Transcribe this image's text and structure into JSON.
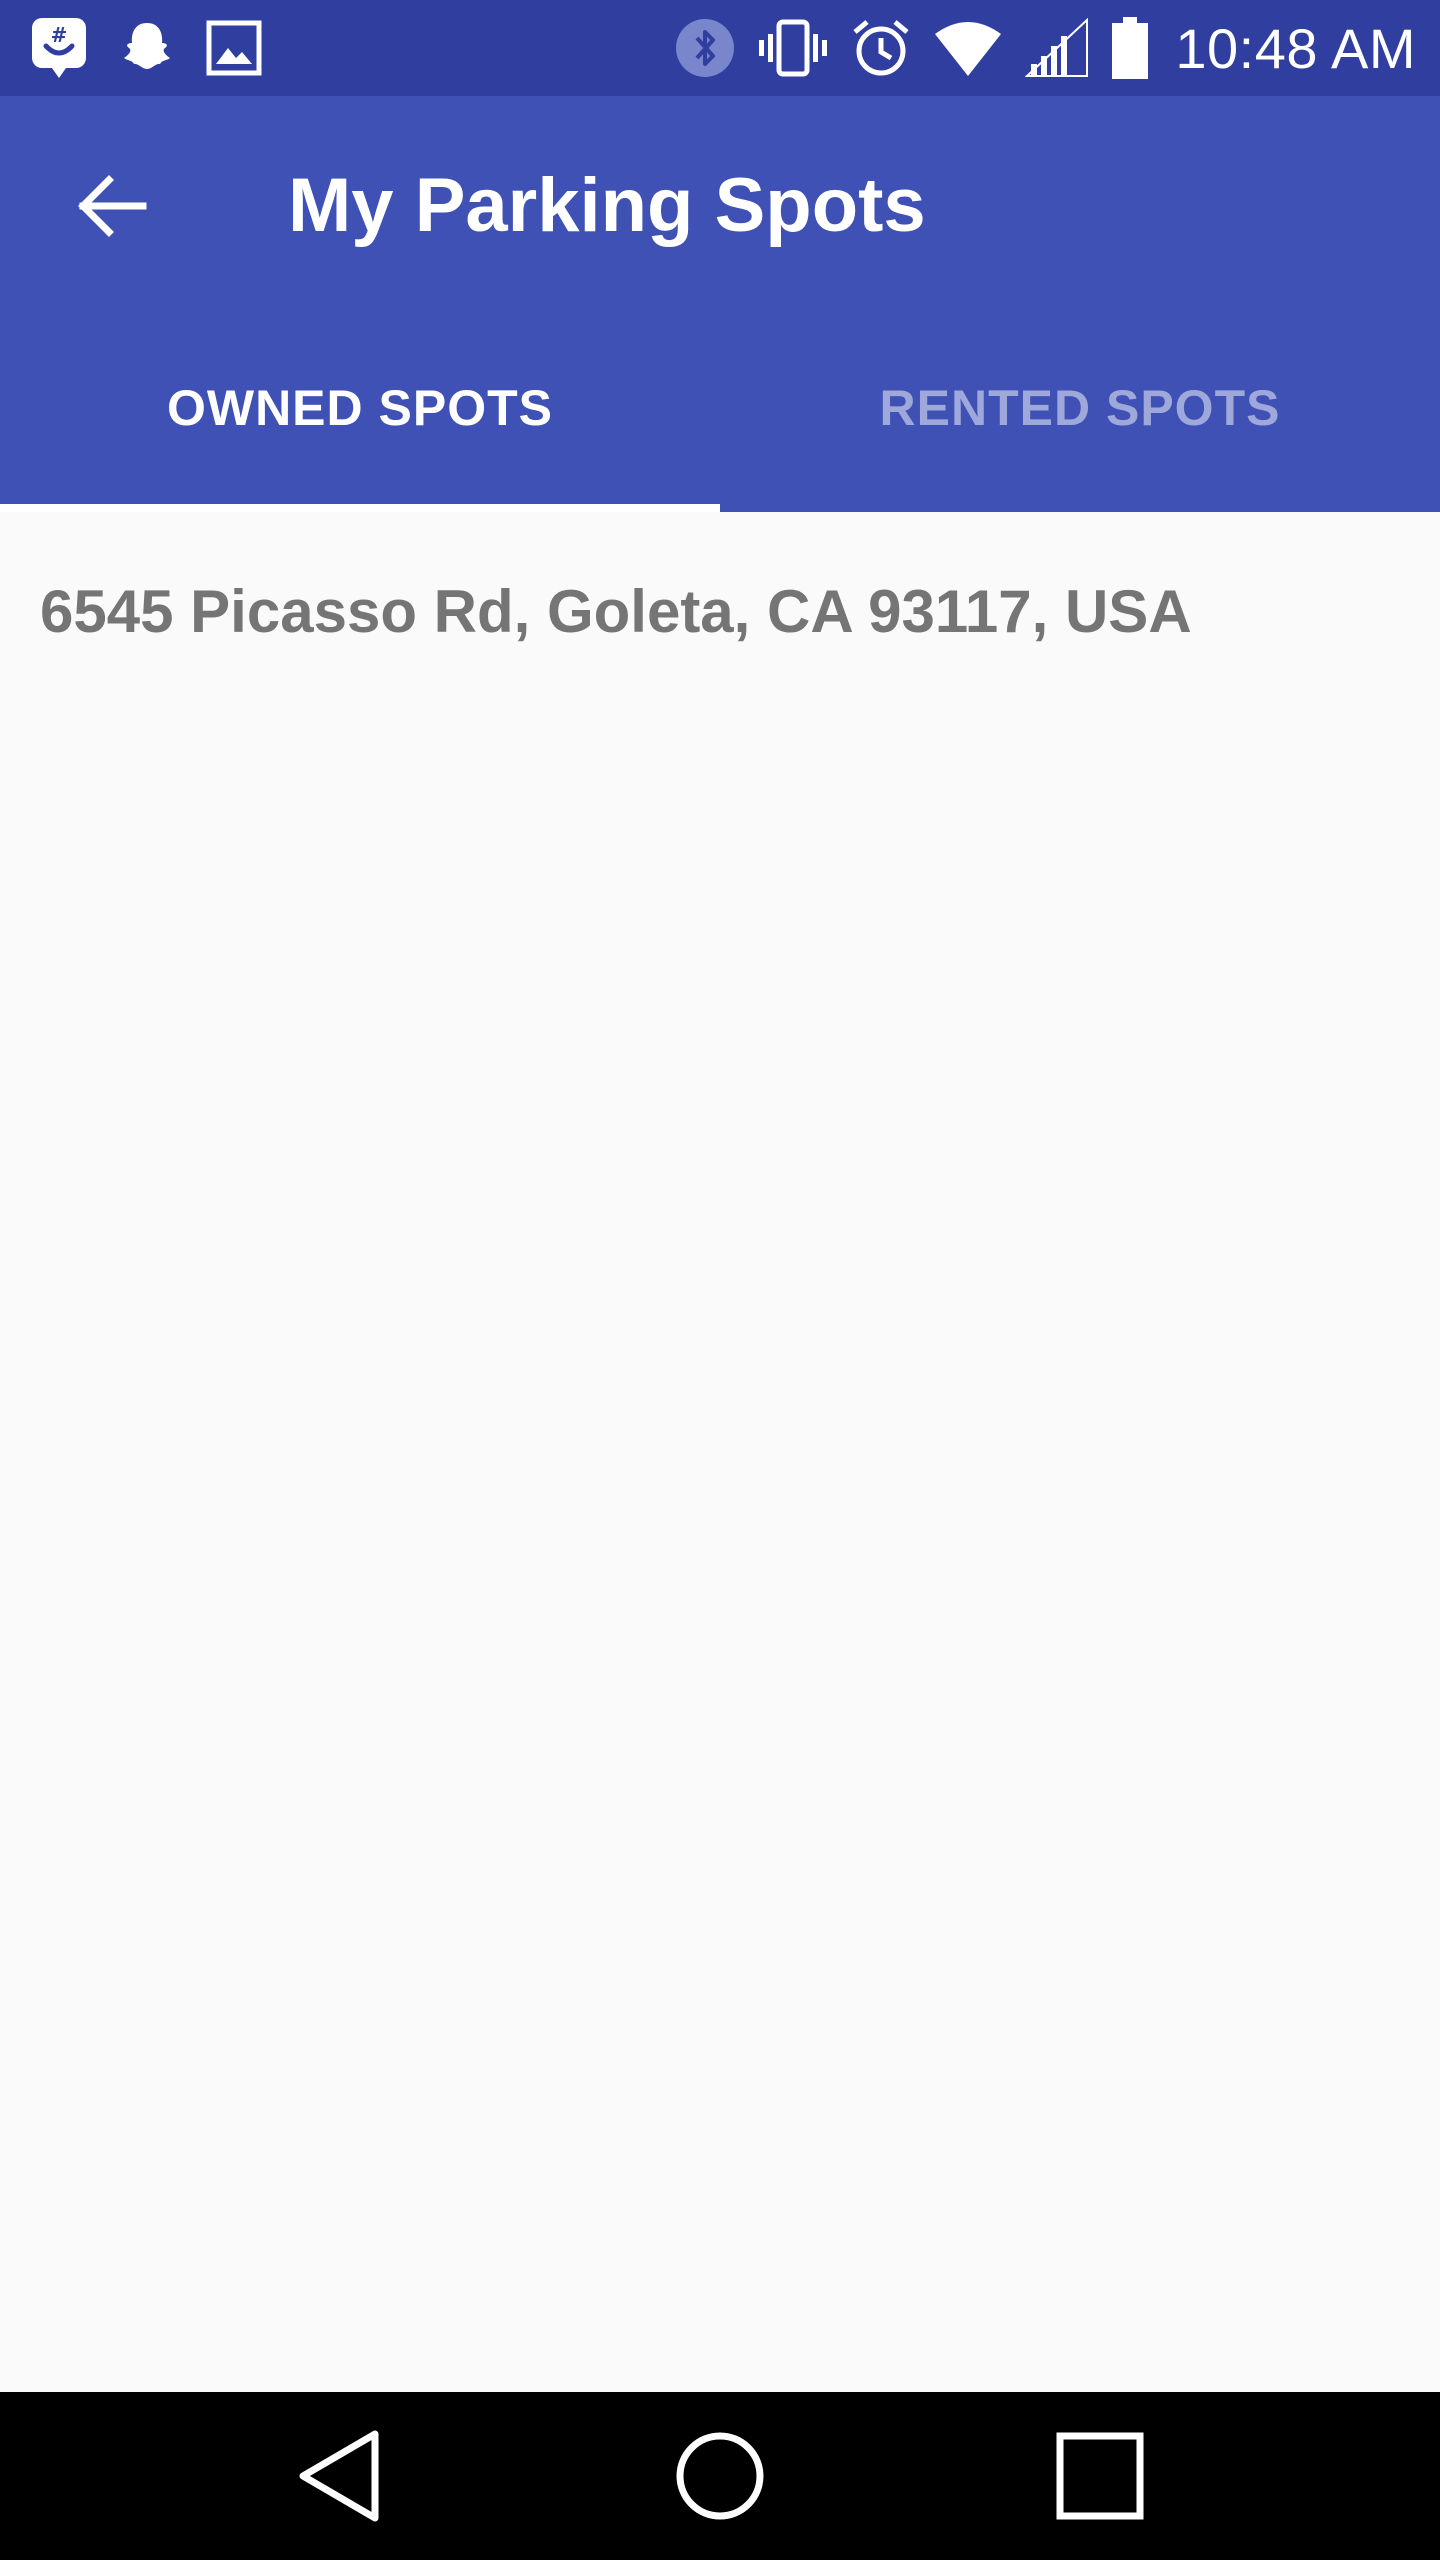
{
  "status_bar": {
    "time": "10:48 AM",
    "left_icons": [
      "groupme-icon",
      "snapchat-icon",
      "gallery-icon"
    ],
    "right_icons": [
      "bluetooth-icon",
      "vibrate-icon",
      "alarm-icon",
      "wifi-icon",
      "signal-icon",
      "battery-icon"
    ],
    "background_color": "#303f9f"
  },
  "app_bar": {
    "title": "My Parking Spots",
    "back_icon": "arrow-back-icon",
    "background_color": "#3f51b5"
  },
  "tabs": [
    {
      "label": "OWNED SPOTS",
      "selected": true
    },
    {
      "label": "RENTED SPOTS",
      "selected": false
    }
  ],
  "spots": [
    {
      "address": "6545 Picasso Rd, Goleta, CA 93117, USA"
    }
  ],
  "nav_bar": {
    "buttons": [
      "back-triangle-icon",
      "home-circle-icon",
      "recents-square-icon"
    ]
  }
}
